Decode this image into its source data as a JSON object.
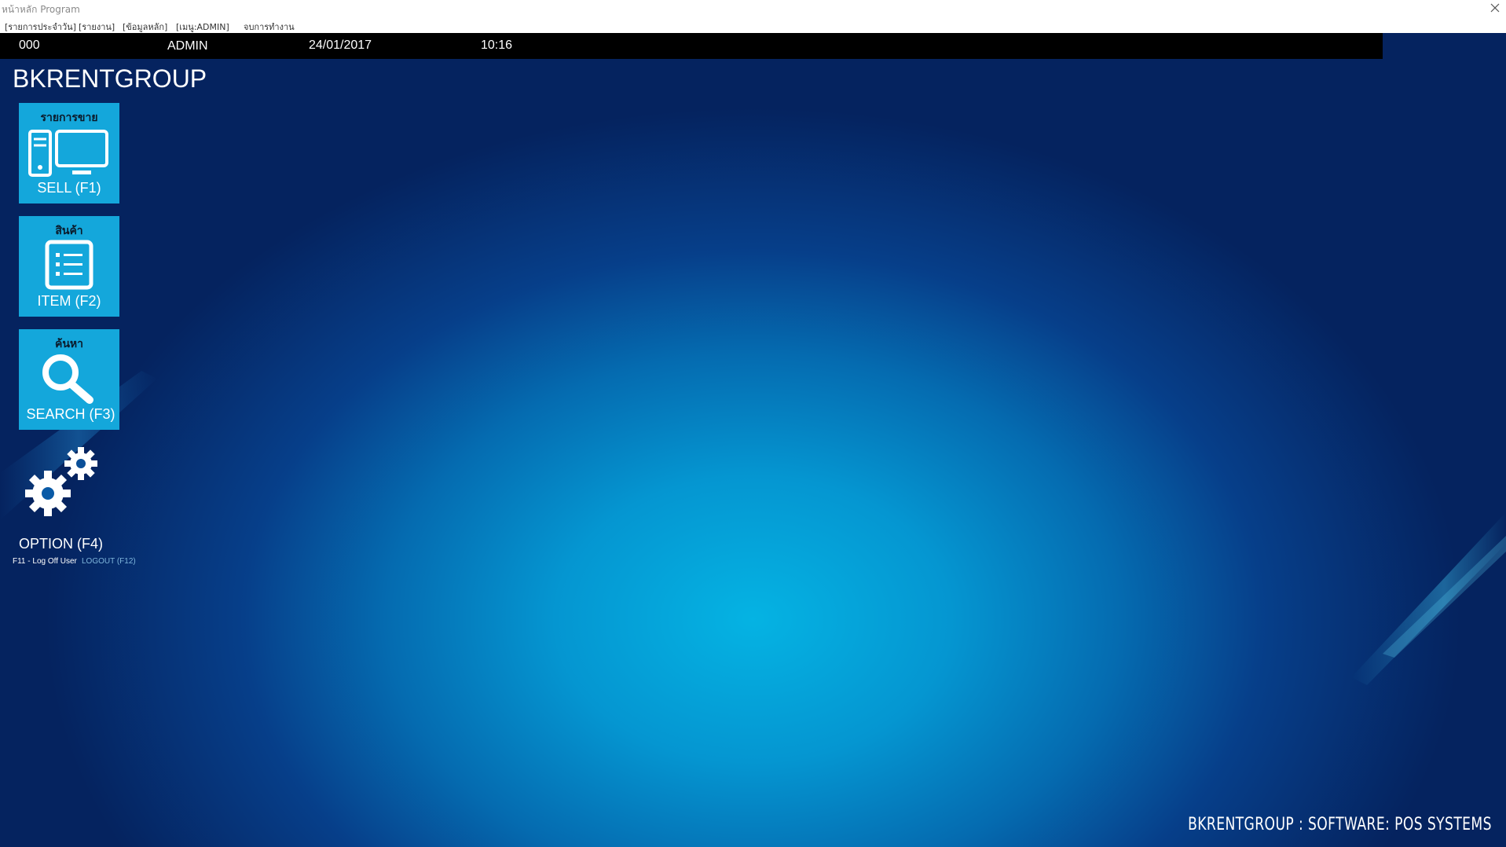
{
  "window": {
    "title": "หน้าหลัก Program"
  },
  "menu": {
    "items": [
      "[รายการประจำวัน]",
      "[รายงาน]",
      "[ข้อมูลหลัก]",
      "[เมนู:ADMIN]",
      "จบการทำงาน"
    ]
  },
  "status": {
    "code": "000",
    "user": "ADMIN",
    "date": "24/01/2017",
    "time": "10:16"
  },
  "brand": "BKRENTGROUP",
  "tiles": {
    "sell": {
      "thai": "รายการขาย",
      "label": "SELL (F1)",
      "icon": "pos-terminal-icon"
    },
    "item": {
      "thai": "สินค้า",
      "label": "ITEM (F2)",
      "icon": "list-icon"
    },
    "search": {
      "thai": "ค้นหา",
      "label": "SEARCH (F3)",
      "icon": "search-icon"
    },
    "option": {
      "label": "OPTION (F4)",
      "icon": "gears-icon"
    }
  },
  "links": {
    "logoff": "F11 - Log Off User",
    "logout": "LOGOUT (F12)"
  },
  "footer": "BKRENTGROUP : SOFTWARE: POS SYSTEMS",
  "colors": {
    "tile": "#14a7db",
    "statusbar": "#000000",
    "background_center": "#05b3e3",
    "background_edge": "#05235f",
    "logout_link": "#7fb6dc"
  }
}
